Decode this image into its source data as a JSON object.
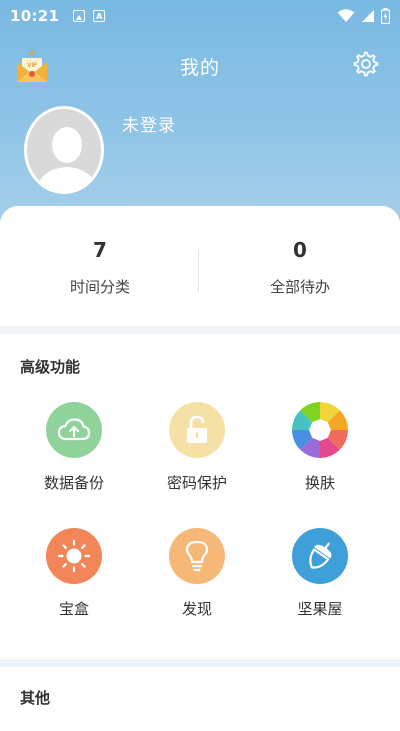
{
  "status_bar": {
    "time": "10:21"
  },
  "header": {
    "title": "我的"
  },
  "profile": {
    "login_text": "未登录"
  },
  "stats": [
    {
      "value": "7",
      "label": "时间分类"
    },
    {
      "value": "0",
      "label": "全部待办"
    }
  ],
  "advanced": {
    "title": "高级功能",
    "items": [
      {
        "label": "数据备份",
        "icon": "cloud-upload-icon",
        "color": "#8fd29a"
      },
      {
        "label": "密码保护",
        "icon": "lock-icon",
        "color": "#f5e1a6"
      },
      {
        "label": "换肤",
        "icon": "color-wheel-icon",
        "color": "#f2f2f2"
      },
      {
        "label": "宝盒",
        "icon": "sun-icon",
        "color": "#f38658"
      },
      {
        "label": "发现",
        "icon": "lightbulb-icon",
        "color": "#f7b777"
      },
      {
        "label": "坚果屋",
        "icon": "acorn-icon",
        "color": "#3f9fd8"
      }
    ]
  },
  "other": {
    "title": "其他"
  },
  "colors": {
    "header_top": "#79b9e3",
    "header_bottom": "#a7d0ea",
    "page_bg": "#eef4f8"
  }
}
